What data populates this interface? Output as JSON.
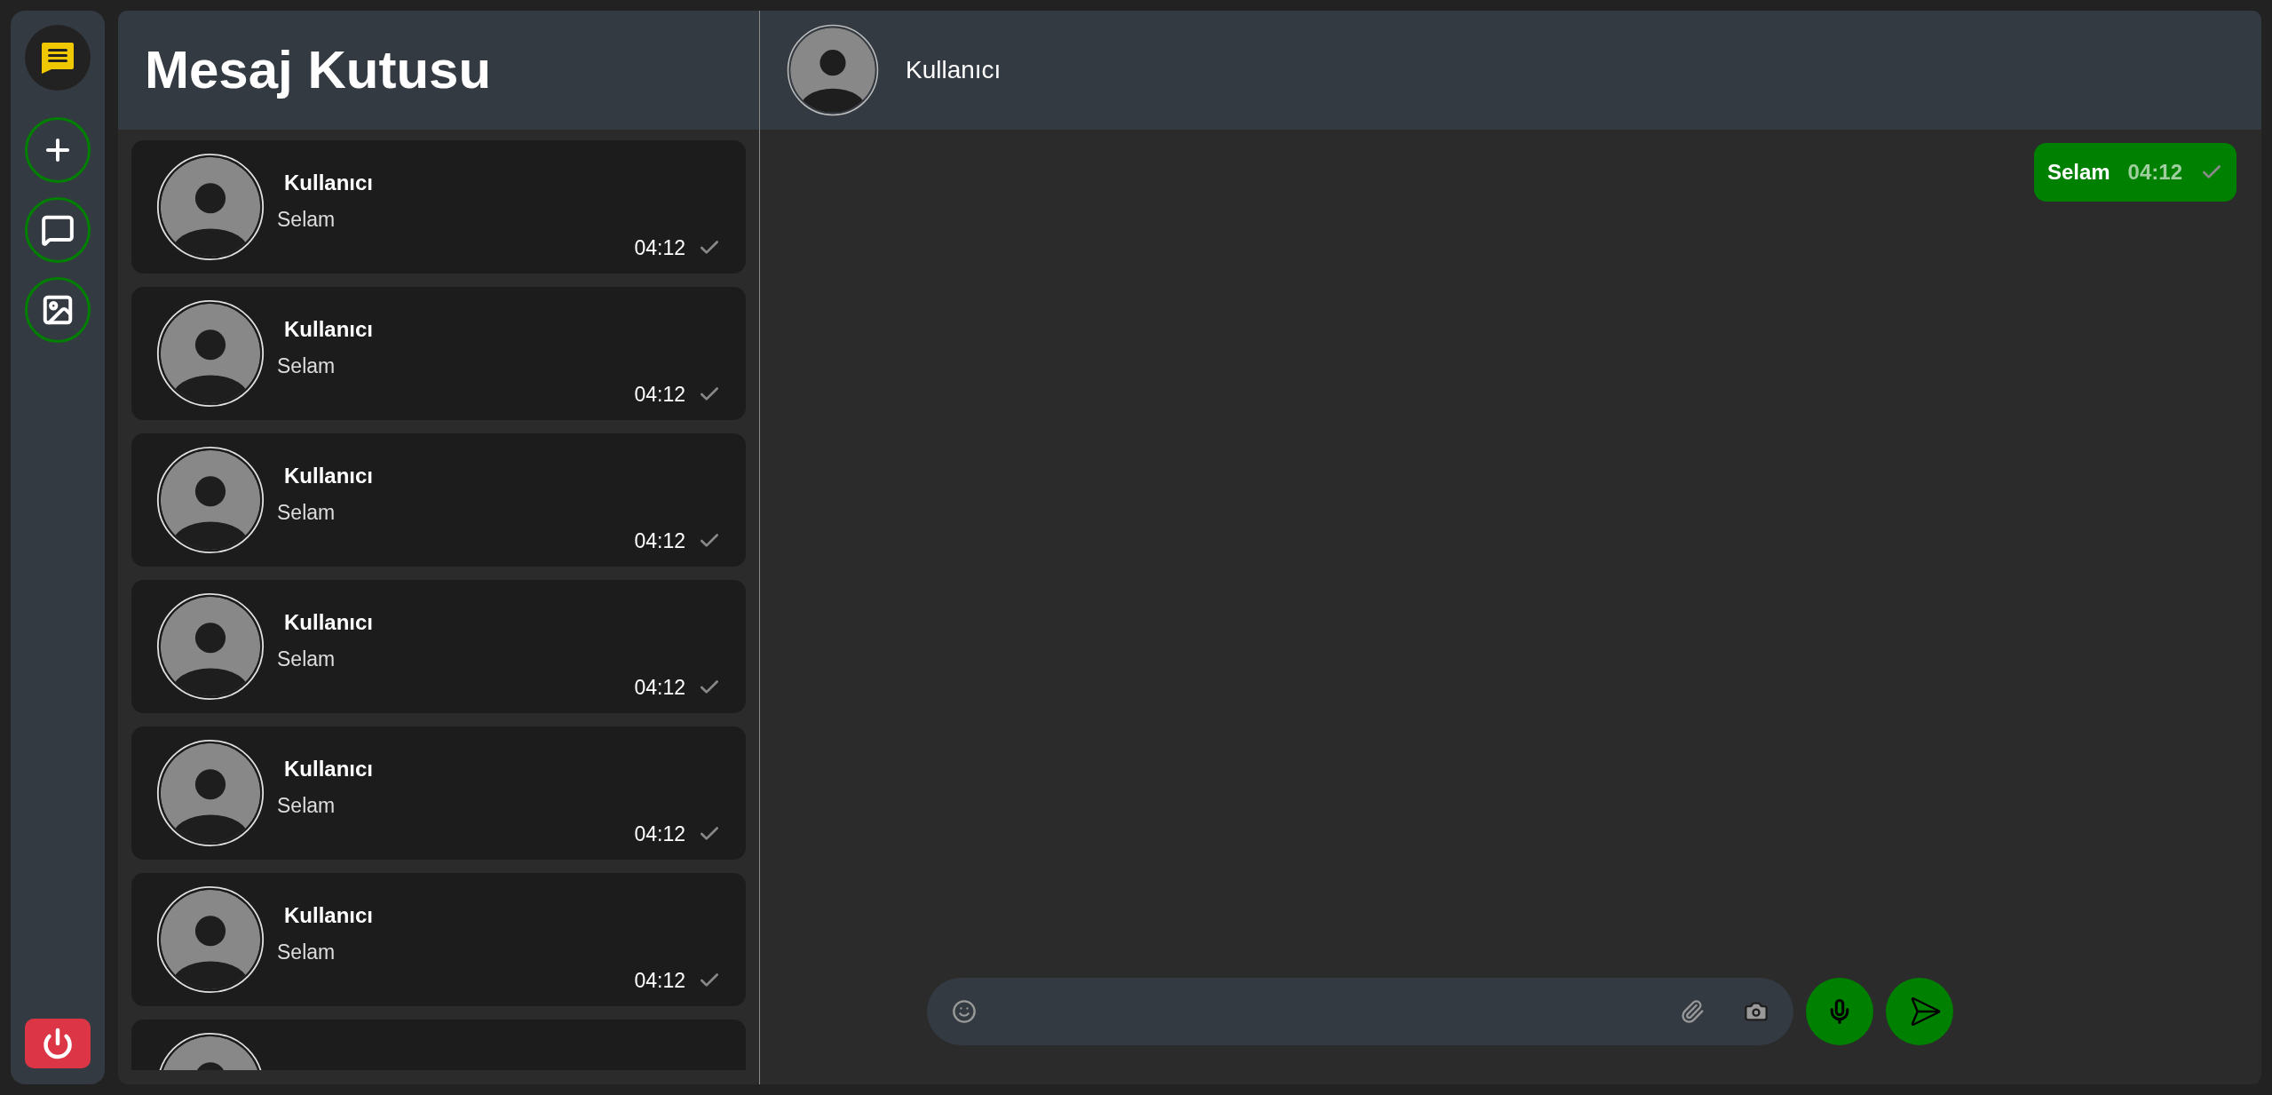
{
  "sidebar": {
    "buttons": [
      {
        "kind": "logo"
      },
      {
        "kind": "add"
      },
      {
        "kind": "chat"
      },
      {
        "kind": "image"
      }
    ]
  },
  "inbox": {
    "title": "Mesaj Kutusu",
    "conversations": [
      {
        "kind": "full",
        "name": "Kullanıcı",
        "preview": "Selam",
        "time": "04:12"
      },
      {
        "kind": "full",
        "name": "Kullanıcı",
        "preview": "Selam",
        "time": "04:12"
      },
      {
        "kind": "full",
        "name": "Kullanıcı",
        "preview": "Selam",
        "time": "04:12"
      },
      {
        "kind": "full",
        "name": "Kullanıcı",
        "preview": "Selam",
        "time": "04:12"
      },
      {
        "kind": "full",
        "name": "Kullanıcı",
        "preview": "Selam",
        "time": "04:12"
      },
      {
        "kind": "full",
        "name": "Kullanıcı",
        "preview": "Selam",
        "time": "04:12"
      },
      {
        "kind": "partial"
      }
    ]
  },
  "chat": {
    "contact": "Kullanıcı",
    "messages": [
      {
        "text": "Selam",
        "time": "04:12"
      }
    ]
  }
}
